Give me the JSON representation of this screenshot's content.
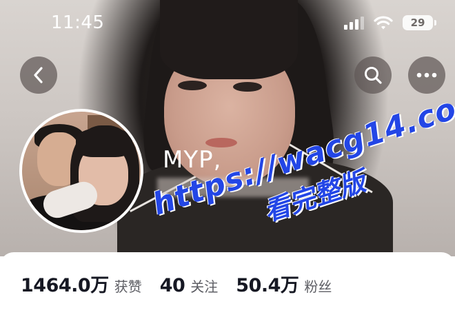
{
  "status_bar": {
    "time": "11:45",
    "battery": "29",
    "signal_icon": "cellular-signal-icon",
    "wifi_icon": "wifi-icon",
    "battery_icon": "battery-icon"
  },
  "nav": {
    "back_icon": "chevron-left-icon",
    "search_icon": "search-icon",
    "more_icon": "more-dots-icon"
  },
  "profile": {
    "username": "MYP,"
  },
  "watermark": {
    "url": "https://wacg14.com",
    "caption": "看完整版"
  },
  "stats": [
    {
      "value": "1464.0万",
      "label": "获赞"
    },
    {
      "value": "40",
      "label": "关注"
    },
    {
      "value": "50.4万",
      "label": "粉丝"
    }
  ],
  "colors": {
    "watermark": "#2346e6",
    "stat_value": "#161823",
    "stat_label": "#5c5d63"
  }
}
